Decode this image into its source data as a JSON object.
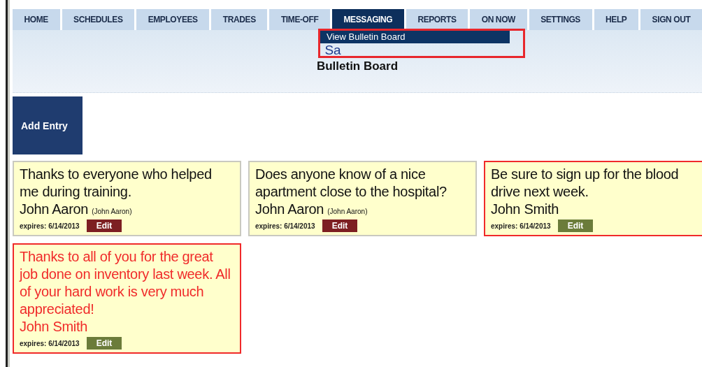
{
  "nav": {
    "tabs": [
      {
        "label": "HOME",
        "selected": false
      },
      {
        "label": "SCHEDULES",
        "selected": false
      },
      {
        "label": "EMPLOYEES",
        "selected": false
      },
      {
        "label": "TRADES",
        "selected": false
      },
      {
        "label": "TIME-OFF",
        "selected": false
      },
      {
        "label": "MESSAGING",
        "selected": true
      },
      {
        "label": "REPORTS",
        "selected": false
      },
      {
        "label": "ON NOW",
        "selected": false
      },
      {
        "label": "SETTINGS",
        "selected": false
      },
      {
        "label": "HELP",
        "selected": false
      },
      {
        "label": "SIGN OUT",
        "selected": false
      }
    ],
    "dropdown": {
      "items": [
        {
          "label": "View Bulletin Board",
          "selected": true
        }
      ]
    }
  },
  "header": {
    "site_name": "Sa",
    "page_title": "Bulletin Board"
  },
  "add_button": "Add Entry",
  "entries": [
    {
      "kind": "standard",
      "message": "Thanks to everyone who helped me during training.",
      "author": "John Aaron",
      "author_note": "(John Aaron)",
      "expires": "expires: 6/14/2013",
      "edit": "Edit"
    },
    {
      "kind": "standard",
      "message": "Does anyone know of a nice apartment close to the hospital?",
      "author": "John Aaron",
      "author_note": "(John Aaron)",
      "expires": "expires: 6/14/2013",
      "edit": "Edit"
    },
    {
      "kind": "flagged",
      "message": "Be sure to sign up for the blood drive next week.",
      "author": "John Smith",
      "expires": "expires: 6/14/2013",
      "edit": "Edit"
    },
    {
      "kind": "urgent",
      "message": "Thanks to all of you for the great job done on inventory last week. All of your hard work is very much appreciated!",
      "author": "John Smith",
      "expires": "expires: 6/14/2013",
      "edit": "Edit"
    }
  ]
}
